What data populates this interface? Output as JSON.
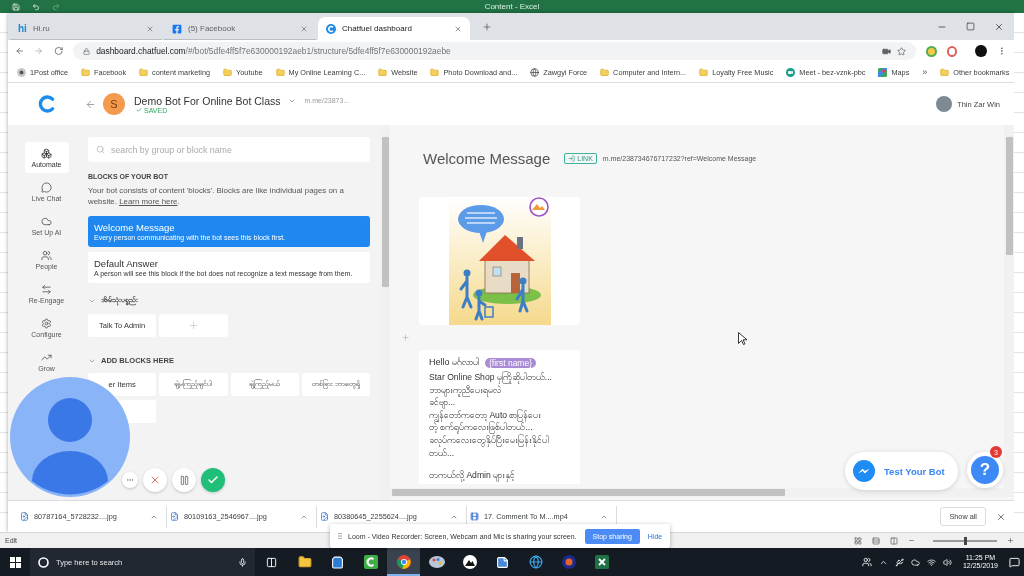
{
  "excel": {
    "title": "Content - Excel",
    "status": "Edit",
    "zoom": {
      "level": 0.5
    }
  },
  "browser": {
    "tabs": [
      {
        "kind": "hi",
        "favicon": "hi",
        "label": "Hi.ru",
        "selected": false
      },
      {
        "kind": "facebook",
        "label": "(5) Facebook",
        "selected": false
      },
      {
        "kind": "chatfuel",
        "label": "Chatfuel dashboard",
        "selected": true
      }
    ],
    "address": {
      "domain": "dashboard.chatfuel.com",
      "path": "/#/bot/5dfe4ff5f7e630000192aeb1/structure/5dfe4ff5f7e630000192aebe"
    },
    "bookmarks": [
      {
        "kind": "site",
        "label": "1Post office"
      },
      {
        "kind": "folder",
        "label": "Facebook"
      },
      {
        "kind": "folder",
        "label": "content marketing"
      },
      {
        "kind": "folder",
        "label": "Youtube"
      },
      {
        "kind": "folder",
        "label": "My Online Learning C..."
      },
      {
        "kind": "folder",
        "label": "Website"
      },
      {
        "kind": "folder",
        "label": "Photo Download and..."
      },
      {
        "kind": "globe",
        "label": "Zawgyi Force"
      },
      {
        "kind": "folder",
        "label": "Computer and Intern..."
      },
      {
        "kind": "folder",
        "label": "Loyalty Free Music"
      },
      {
        "kind": "meet",
        "label": "Meet - bez-vznk-pbc"
      },
      {
        "kind": "maps",
        "label": "Maps"
      }
    ],
    "more_bookmarks": "»",
    "other_bookmarks": "Other bookmarks"
  },
  "app": {
    "bot": {
      "initial": "S",
      "name": "Demo Bot For Online Bot Class",
      "link": "m.me/23873...",
      "status": "SAVED"
    },
    "user": {
      "name": "Thin Zar Win"
    },
    "nav": [
      {
        "kind": "automate",
        "label": "Automate",
        "selected": true
      },
      {
        "kind": "chat",
        "label": "Live Chat",
        "selected": false
      },
      {
        "kind": "ai",
        "label": "Set Up AI",
        "selected": false
      },
      {
        "kind": "people",
        "label": "People",
        "selected": false
      },
      {
        "kind": "reengage",
        "label": "Re-Engage",
        "selected": false
      },
      {
        "kind": "configure",
        "label": "Configure",
        "selected": false
      },
      {
        "kind": "grow",
        "label": "Grow",
        "selected": false
      }
    ],
    "search": {
      "placeholder": "search by group or block name"
    },
    "blocks": {
      "heading": "BLOCKS OF YOUR BOT",
      "intro": "Your bot consists of content 'blocks'. Blocks are like individual pages on a website.",
      "learn_more": "Learn more here",
      "intro_end": ".",
      "main": [
        {
          "title": "Welcome Message",
          "description": "Every person communicating with the bot sees this block first.",
          "selected": true
        },
        {
          "title": "Default Answer",
          "description": "A person will see this block if the bot does not recognize a text message from them.",
          "selected": false
        }
      ],
      "groups": [
        {
          "name": "အိမ်သုံးပစ္စည်း",
          "expanded": true,
          "items": [
            {
              "kind": "block",
              "label": "Talk To Admin"
            },
            {
              "kind": "add"
            }
          ]
        },
        {
          "name": "ADD BLOCKS HERE",
          "expanded": true,
          "items": [
            {
              "kind": "block",
              "label": "er Items"
            },
            {
              "kind": "block",
              "label": "ချဲ့မကြည့်ချင်ပါ"
            },
            {
              "kind": "block",
              "label": "ချဲ့ကြည့်မယ်"
            },
            {
              "kind": "block",
              "label": "တစ်ခြား ဘာတွေရှိ"
            },
            {
              "kind": "block"
            }
          ]
        }
      ]
    },
    "editor": {
      "title": "Welcome Message",
      "link_badge": "LINK",
      "link": "m.me/238734676717232?ref=Welcome Message",
      "cards": [
        {
          "kind": "image"
        },
        {
          "kind": "text",
          "greeting": "Hello မင်္ဂလာပါ",
          "variable": "{first name}",
          "paragraphs": [
            [
              "Star Online Shop မှကြိုဆိုပါတယ်...",
              "ဘာများကူညီပေးရမလဲ",
              "ခင်ဗျာ...",
              "ကျွန်တော်ကတော့ Auto စာပြန်ပေး",
              "တဲ့ စက်ရုပ်ကလေးဖြစ်ပါတယ်...",
              "ခလုပ်ကလေးတွေနှိပ်ပြီးမေးမြန်းနိုင်ပါ",
              "တယ်..."
            ],
            [
              "တကယ်လို့ Admin များနှင့်"
            ]
          ]
        }
      ]
    },
    "test_button": "Test Your Bot",
    "help": {
      "label": "?",
      "badge": "3"
    }
  },
  "downloads": {
    "items": [
      {
        "kind": "image",
        "name": "80787164_5728232....jpg"
      },
      {
        "kind": "image",
        "name": "80109163_2546967....jpg"
      },
      {
        "kind": "image",
        "name": "80380645_2255624....jpg"
      },
      {
        "kind": "video",
        "name": "17. Comment To M....mp4"
      }
    ],
    "show_all": "Show all"
  },
  "loom": {
    "controls": [
      {
        "kind": "more"
      },
      {
        "kind": "cancel"
      },
      {
        "kind": "pause"
      },
      {
        "kind": "done"
      }
    ],
    "notice": {
      "text": "Loom - Video Recorder: Screen, Webcam and Mic is sharing your screen.",
      "stop": "Stop sharing",
      "hide": "Hide"
    }
  },
  "taskbar": {
    "search": {
      "placeholder": "Type here to search"
    },
    "apps": [
      {
        "kind": "explorer",
        "selected": false
      },
      {
        "kind": "store",
        "selected": false
      },
      {
        "kind": "camtasia",
        "selected": false
      },
      {
        "kind": "chrome",
        "selected": true
      },
      {
        "kind": "paint",
        "selected": false
      },
      {
        "kind": "photos",
        "selected": false
      },
      {
        "kind": "notes",
        "selected": false
      },
      {
        "kind": "edge",
        "selected": false
      },
      {
        "kind": "app",
        "selected": false
      },
      {
        "kind": "excel",
        "selected": false
      }
    ],
    "time": "11:25 PM",
    "date": "12/25/2019"
  }
}
